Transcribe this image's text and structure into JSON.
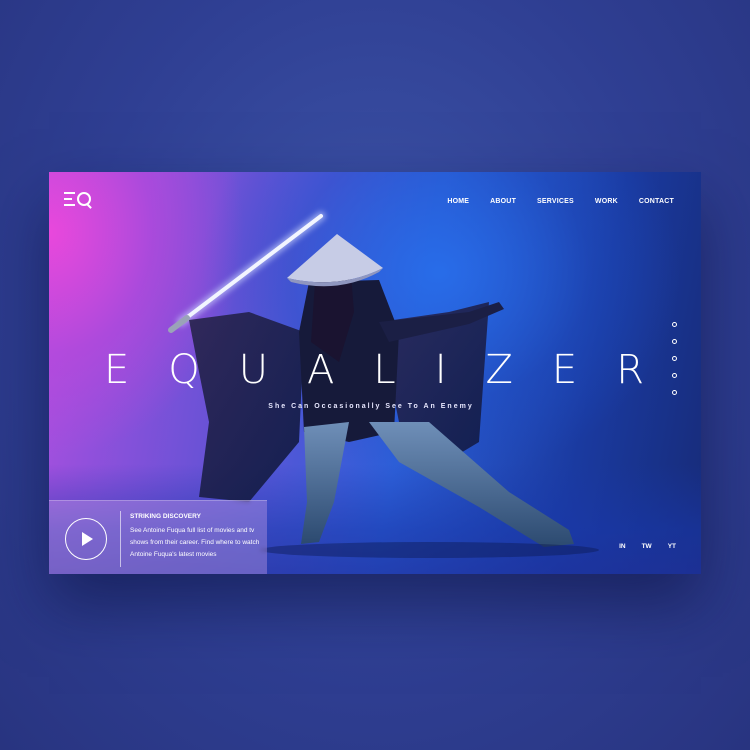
{
  "brand": {
    "logo_icon": "eq-logo-icon"
  },
  "nav": {
    "items": [
      {
        "label": "HOME"
      },
      {
        "label": "ABOUT"
      },
      {
        "label": "SERVICES"
      },
      {
        "label": "WORK"
      },
      {
        "label": "CONTACT"
      }
    ]
  },
  "hero": {
    "title_letters": [
      "E",
      "Q",
      "U",
      "A",
      "L",
      "I",
      "Z",
      "E",
      "R"
    ],
    "subtitle": "She Can Occasionally See To An Enemy"
  },
  "pager": {
    "count": 5,
    "active_index": 0
  },
  "info": {
    "play_icon": "play-icon",
    "heading": "STRIKING DISCOVERY",
    "text": "See Antoine Fuqua full list of movies and tv shows from their career. Find where to watch Antoine Fuqua's latest movies"
  },
  "social": {
    "items": [
      {
        "label": "IN"
      },
      {
        "label": "TW"
      },
      {
        "label": "YT"
      }
    ]
  },
  "colors": {
    "pink": "#e048dc",
    "blue": "#2d5fd8",
    "deep_blue": "#172b78",
    "background": "#2f3f93",
    "saber": "#e6ecff"
  }
}
